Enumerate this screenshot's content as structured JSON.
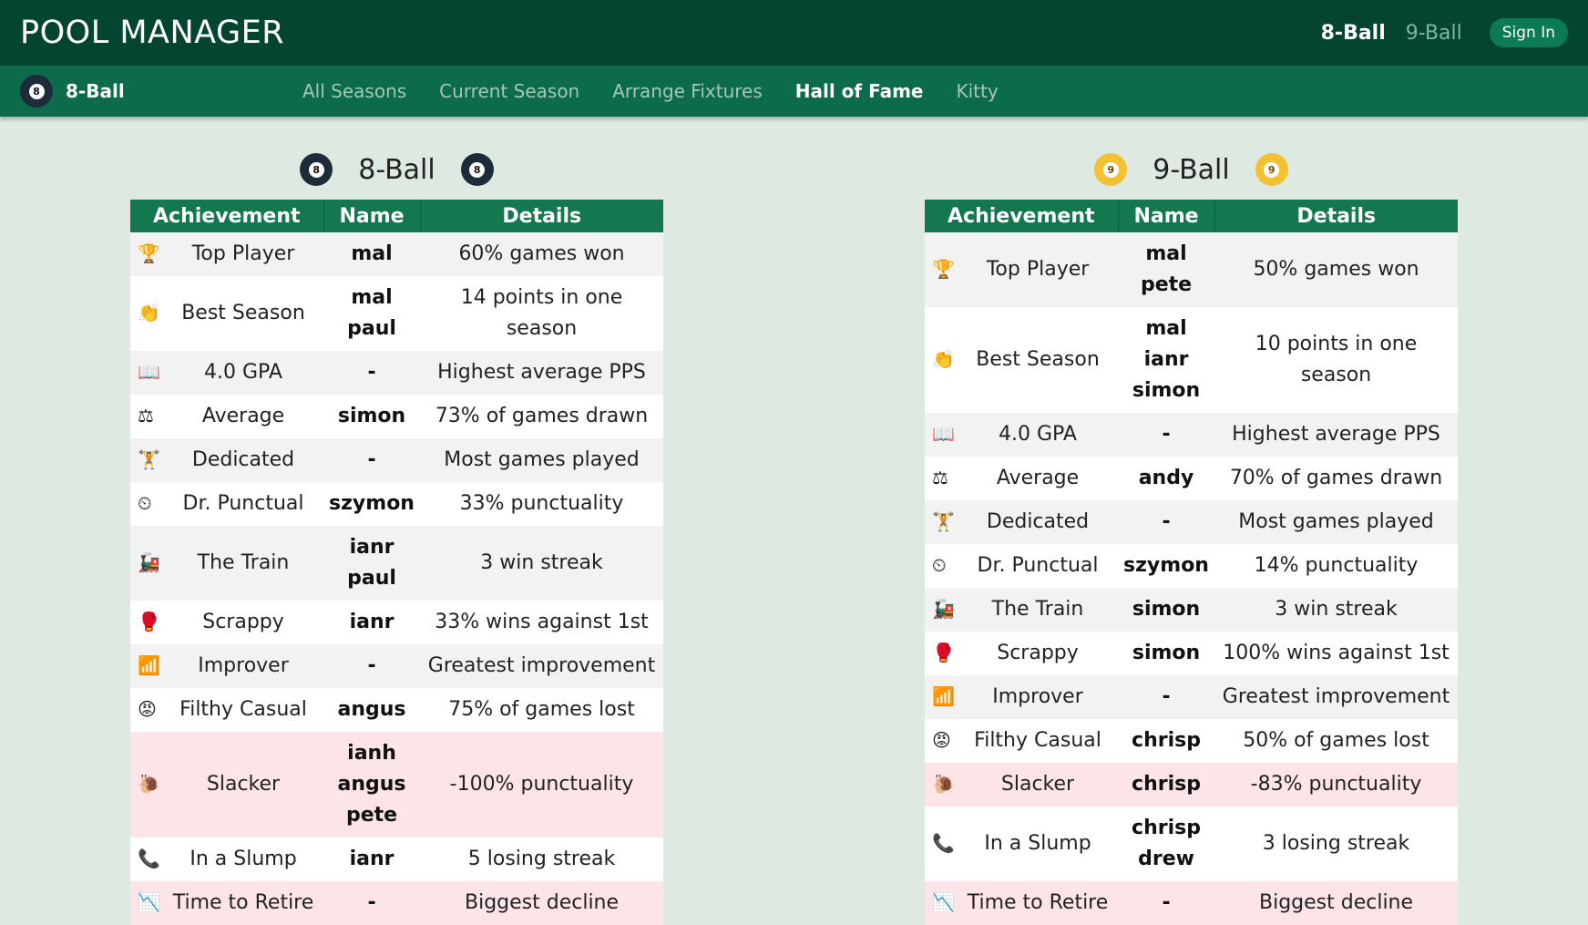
{
  "header": {
    "brand": "POOL MANAGER",
    "links": [
      {
        "label": "8-Ball",
        "active": true
      },
      {
        "label": "9-Ball",
        "active": false
      }
    ],
    "signin": "Sign In"
  },
  "subnav": {
    "ball_number": "8",
    "title": "8-Ball",
    "links": [
      {
        "label": "All Seasons",
        "active": false
      },
      {
        "label": "Current Season",
        "active": false
      },
      {
        "label": "Arrange Fixtures",
        "active": false
      },
      {
        "label": "Hall of Fame",
        "active": true
      },
      {
        "label": "Kitty",
        "active": false
      }
    ]
  },
  "columns": {
    "achievement": "Achievement",
    "name": "Name",
    "details": "Details"
  },
  "panels": [
    {
      "title": "8-Ball",
      "ball_number": "8",
      "ball_type": "eight",
      "rows": [
        {
          "icon": "trophy-icon",
          "glyph": "🏆",
          "achievement": "Top Player",
          "names": [
            "mal"
          ],
          "details": "60% games won",
          "negative": false
        },
        {
          "icon": "clapping-icon",
          "glyph": "👏",
          "achievement": "Best Season",
          "names": [
            "mal",
            "paul"
          ],
          "details": "14 points in one season",
          "negative": false
        },
        {
          "icon": "book-icon",
          "glyph": "📖",
          "achievement": "4.0 GPA",
          "names": [
            "-"
          ],
          "details": "Highest average PPS",
          "negative": false
        },
        {
          "icon": "scales-icon",
          "glyph": "⚖",
          "achievement": "Average",
          "names": [
            "simon"
          ],
          "details": "73% of games drawn",
          "negative": false
        },
        {
          "icon": "weightlifter-icon",
          "glyph": "🏋",
          "achievement": "Dedicated",
          "names": [
            "-"
          ],
          "details": "Most games played",
          "negative": false
        },
        {
          "icon": "clock-icon",
          "glyph": "⏲",
          "achievement": "Dr. Punctual",
          "names": [
            "szymon"
          ],
          "details": "33% punctuality",
          "negative": false
        },
        {
          "icon": "train-icon",
          "glyph": "🚂",
          "achievement": "The Train",
          "names": [
            "ianr",
            "paul"
          ],
          "details": "3 win streak",
          "negative": false
        },
        {
          "icon": "boxing-glove-icon",
          "glyph": "🥊",
          "achievement": "Scrappy",
          "names": [
            "ianr"
          ],
          "details": "33% wins against 1st",
          "negative": false
        },
        {
          "icon": "chart-icon",
          "glyph": "📶",
          "achievement": "Improver",
          "names": [
            "-"
          ],
          "details": "Greatest improvement",
          "negative": false
        },
        {
          "icon": "angry-face-icon",
          "glyph": "😡",
          "achievement": "Filthy Casual",
          "names": [
            "angus"
          ],
          "details": "75% of games lost",
          "negative": false
        },
        {
          "icon": "snail-icon",
          "glyph": "🐌",
          "achievement": "Slacker",
          "names": [
            "ianh",
            "angus",
            "pete"
          ],
          "details": "-100% punctuality",
          "negative": true
        },
        {
          "icon": "phone-icon",
          "glyph": "📞",
          "achievement": "In a Slump",
          "names": [
            "ianr"
          ],
          "details": "5 losing streak",
          "negative": false
        },
        {
          "icon": "decline-chart-icon",
          "glyph": "📉",
          "achievement": "Time to Retire",
          "names": [
            "-"
          ],
          "details": "Biggest decline",
          "negative": true
        }
      ]
    },
    {
      "title": "9-Ball",
      "ball_number": "9",
      "ball_type": "nine",
      "rows": [
        {
          "icon": "trophy-icon",
          "glyph": "🏆",
          "achievement": "Top Player",
          "names": [
            "mal",
            "pete"
          ],
          "details": "50% games won",
          "negative": false
        },
        {
          "icon": "clapping-icon",
          "glyph": "👏",
          "achievement": "Best Season",
          "names": [
            "mal",
            "ianr",
            "simon"
          ],
          "details": "10 points in one season",
          "negative": false
        },
        {
          "icon": "book-icon",
          "glyph": "📖",
          "achievement": "4.0 GPA",
          "names": [
            "-"
          ],
          "details": "Highest average PPS",
          "negative": false
        },
        {
          "icon": "scales-icon",
          "glyph": "⚖",
          "achievement": "Average",
          "names": [
            "andy"
          ],
          "details": "70% of games drawn",
          "negative": false
        },
        {
          "icon": "weightlifter-icon",
          "glyph": "🏋",
          "achievement": "Dedicated",
          "names": [
            "-"
          ],
          "details": "Most games played",
          "negative": false
        },
        {
          "icon": "clock-icon",
          "glyph": "⏲",
          "achievement": "Dr. Punctual",
          "names": [
            "szymon"
          ],
          "details": "14% punctuality",
          "negative": false
        },
        {
          "icon": "train-icon",
          "glyph": "🚂",
          "achievement": "The Train",
          "names": [
            "simon"
          ],
          "details": "3 win streak",
          "negative": false
        },
        {
          "icon": "boxing-glove-icon",
          "glyph": "🥊",
          "achievement": "Scrappy",
          "names": [
            "simon"
          ],
          "details": "100% wins against 1st",
          "negative": false
        },
        {
          "icon": "chart-icon",
          "glyph": "📶",
          "achievement": "Improver",
          "names": [
            "-"
          ],
          "details": "Greatest improvement",
          "negative": false
        },
        {
          "icon": "angry-face-icon",
          "glyph": "😡",
          "achievement": "Filthy Casual",
          "names": [
            "chrisp"
          ],
          "details": "50% of games lost",
          "negative": false
        },
        {
          "icon": "snail-icon",
          "glyph": "🐌",
          "achievement": "Slacker",
          "names": [
            "chrisp"
          ],
          "details": "-83% punctuality",
          "negative": true
        },
        {
          "icon": "phone-icon",
          "glyph": "📞",
          "achievement": "In a Slump",
          "names": [
            "chrisp",
            "drew"
          ],
          "details": "3 losing streak",
          "negative": false
        },
        {
          "icon": "decline-chart-icon",
          "glyph": "📉",
          "achievement": "Time to Retire",
          "names": [
            "-"
          ],
          "details": "Biggest decline",
          "negative": true
        }
      ]
    }
  ]
}
